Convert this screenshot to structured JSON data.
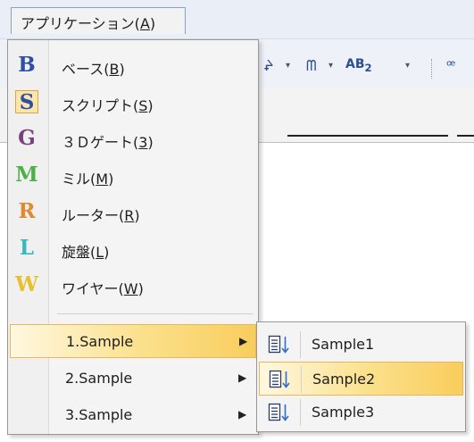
{
  "menubar": {
    "item_label": "アプリケーション(",
    "item_accel": "A",
    "item_close": ")"
  },
  "toolbar": {
    "glyph1": "ᖨ",
    "glyph2": "ᗰ",
    "glyph3": "AB",
    "glyph3_sub": "2",
    "glyph4": "ꟹ",
    "arrow": "▾"
  },
  "dropdown": {
    "items": [
      {
        "icon_letter": "B",
        "icon_color": "#2b4ea6",
        "label": "ベース(",
        "accel": "B",
        "close": ")",
        "checked": false
      },
      {
        "icon_letter": "S",
        "icon_color": "#2b4ea6",
        "label": "スクリプト(",
        "accel": "S",
        "close": ")",
        "checked": true
      },
      {
        "icon_letter": "G",
        "icon_color": "#7a3f7f",
        "label": "３Ｄゲート(",
        "accel": "3",
        "close": ")",
        "checked": false
      },
      {
        "icon_letter": "M",
        "icon_color": "#4fb04a",
        "label": "ミル(",
        "accel": "M",
        "close": ")",
        "checked": false
      },
      {
        "icon_letter": "R",
        "icon_color": "#e08a2e",
        "label": "ルーター(",
        "accel": "R",
        "close": ")",
        "checked": false
      },
      {
        "icon_letter": "L",
        "icon_color": "#3cb6c2",
        "label": "旋盤(",
        "accel": "L",
        "close": ")",
        "checked": false
      },
      {
        "icon_letter": "W",
        "icon_color": "#e6c12a",
        "label": "ワイヤー(",
        "accel": "W",
        "close": ")",
        "checked": false
      }
    ],
    "submenus": [
      {
        "label": "1.Sample",
        "highlighted": true
      },
      {
        "label": "2.Sample",
        "highlighted": false
      },
      {
        "label": "3.Sample",
        "highlighted": false
      }
    ],
    "arrow_glyph": "▶"
  },
  "submenu": {
    "items": [
      {
        "label": "Sample1",
        "highlighted": false
      },
      {
        "label": "Sample2",
        "highlighted": true
      },
      {
        "label": "Sample3",
        "highlighted": false
      }
    ]
  }
}
